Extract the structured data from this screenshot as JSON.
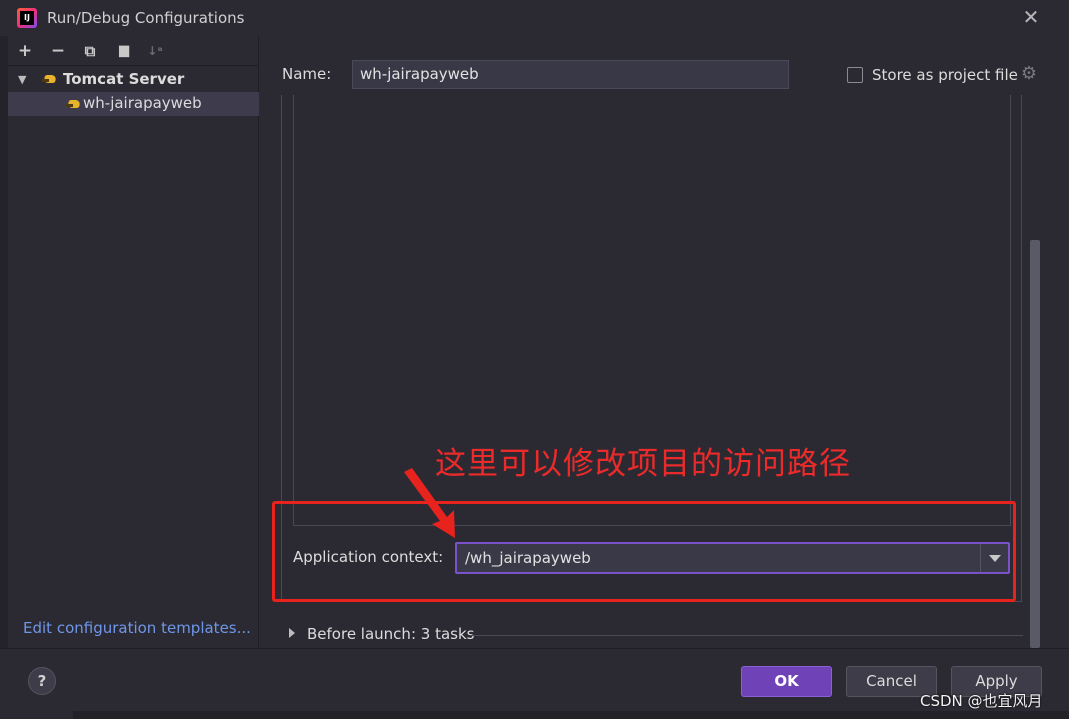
{
  "window": {
    "title": "Run/Debug Configurations",
    "close_glyph": "✕",
    "app_icon": "intellij-icon"
  },
  "toolbar": {
    "add": "+",
    "remove": "−",
    "copy": "⧉",
    "folder": "▆",
    "sort": "↓ᵃ"
  },
  "tree": {
    "group_label": "Tomcat Server",
    "group_chevron": "▼",
    "item_label": "wh-jairapayweb"
  },
  "edit_templates_link": "Edit configuration templates...",
  "form": {
    "name_label": "Name:",
    "name_value": "wh-jairapayweb",
    "store_label": "Store as project file",
    "store_checked": false
  },
  "annotation": {
    "text": "这里可以修改项目的访问路径",
    "color": "#e8221d"
  },
  "context": {
    "label": "Application context:",
    "value": "/wh_jairapayweb"
  },
  "before_launch": {
    "label": "Before launch: 3 tasks"
  },
  "buttons": {
    "help": "?",
    "ok": "OK",
    "cancel": "Cancel",
    "apply": "Apply"
  },
  "watermark": "CSDN @也宜风月",
  "colors": {
    "accent": "#6f42b8",
    "focus_border": "#7a52c9",
    "link": "#6f97e8",
    "background": "#2b2a33"
  }
}
